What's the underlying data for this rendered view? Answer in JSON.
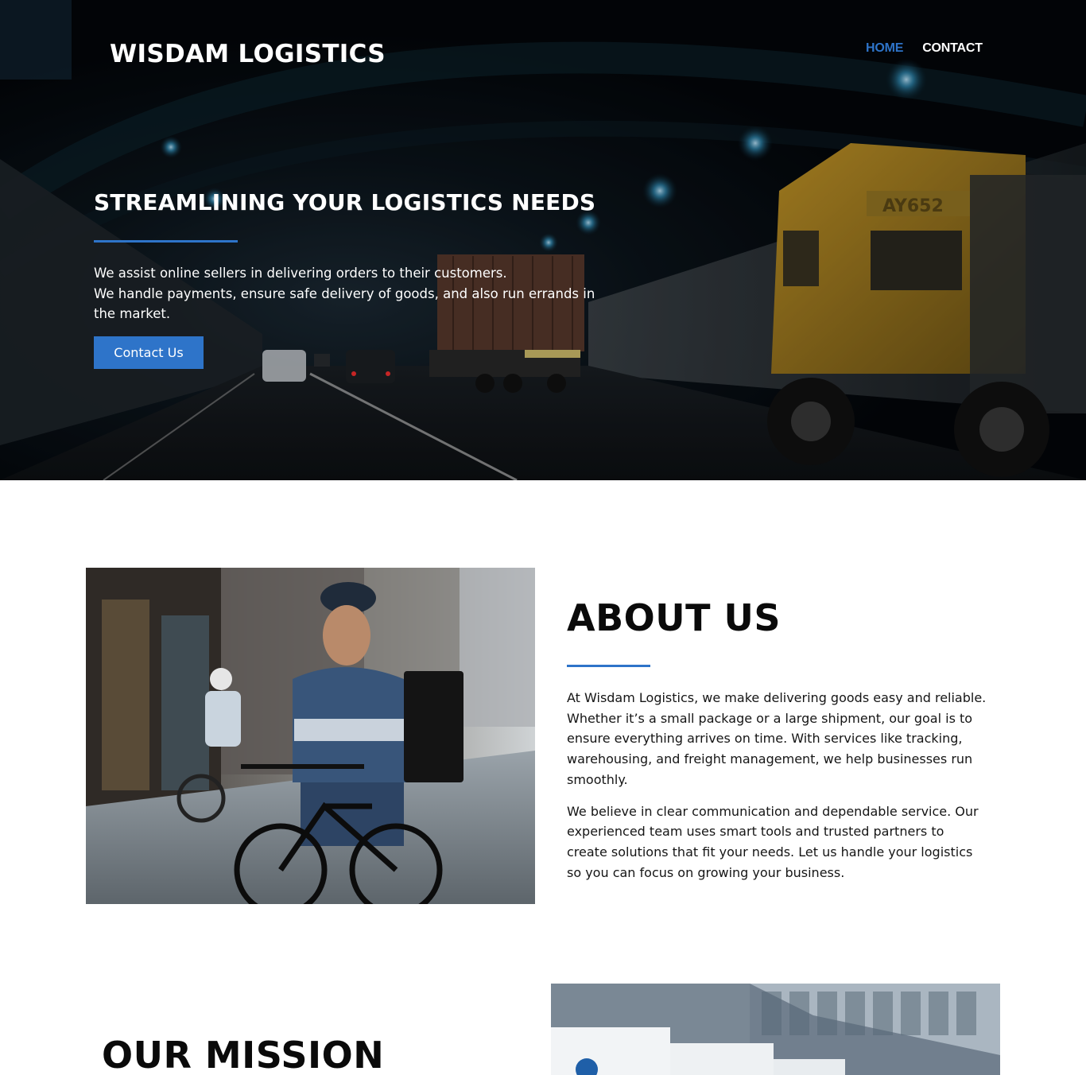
{
  "header": {
    "brand": "WISDAM LOGISTICS",
    "nav": [
      {
        "label": "HOME",
        "active": true
      },
      {
        "label": "CONTACT",
        "active": false
      }
    ]
  },
  "hero": {
    "title": "STREAMLINING YOUR LOGISTICS NEEDS",
    "line1": "We assist online sellers in delivering orders to their customers.",
    "line2": "We handle payments, ensure safe delivery of goods, and also run errands in the market.",
    "button": "Contact Us",
    "truck_plate": "AY652"
  },
  "about": {
    "title": "ABOUT US",
    "p1": "At Wisdam Logistics, we make delivering goods easy and reliable. Whether it’s a small package or a large shipment, our goal is to ensure everything arrives on time. With services like tracking, warehousing, and freight management, we help businesses run smoothly.",
    "p2": "We believe in clear communication and dependable service. Our experienced team uses smart tools and trusted partners to create solutions that fit your needs. Let us handle your logistics so you can focus on growing your business."
  },
  "mission": {
    "title": "OUR MISSION"
  },
  "colors": {
    "accent": "#2e74c9",
    "hero_bg": "#05080c",
    "text": "#151515"
  }
}
